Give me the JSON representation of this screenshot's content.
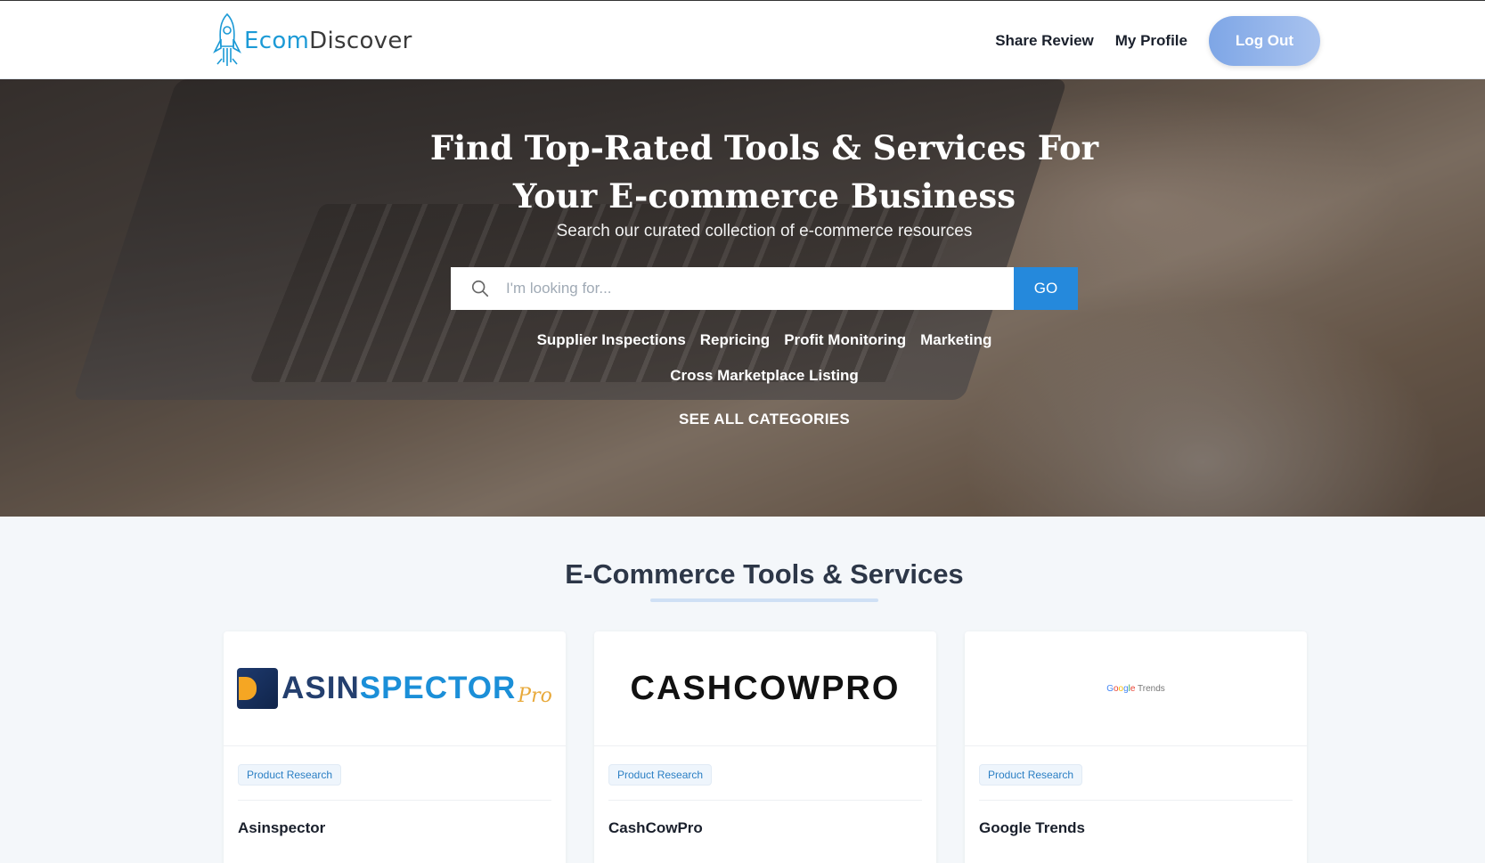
{
  "header": {
    "logo": {
      "part1": "Ecom",
      "part2": "Discover"
    },
    "nav": {
      "share_review": "Share Review",
      "my_profile": "My Profile",
      "log_out": "Log Out"
    }
  },
  "hero": {
    "title_line1": "Find Top-Rated Tools & Services For",
    "title_line2": "Your E-commerce Business",
    "subtitle": "Search our curated collection of e-commerce resources",
    "search": {
      "placeholder": "I'm looking for...",
      "value": "",
      "go_label": "GO"
    },
    "categories": [
      "Supplier Inspections",
      "Repricing",
      "Profit Monitoring",
      "Marketing",
      "Cross Marketplace Listing"
    ],
    "see_all": "SEE ALL CATEGORIES"
  },
  "tools": {
    "heading": "E-Commerce Tools & Services",
    "cards": [
      {
        "logo": {
          "a": "ASIN",
          "b": "SPECTOR",
          "pro": "Pro"
        },
        "tag": "Product Research",
        "name": "Asinspector"
      },
      {
        "logo": {
          "text": "CASHCOWPRO"
        },
        "tag": "Product Research",
        "name": "CashCowPro"
      },
      {
        "logo": {
          "g1": "G",
          "g2": "o",
          "g3": "o",
          "g4": "g",
          "g5": "l",
          "g6": "e",
          "trends": " Trends"
        },
        "tag": "Product Research",
        "name": "Google Trends"
      }
    ]
  },
  "colors": {
    "brand_blue": "#1c9ad6",
    "go_button": "#2589dc",
    "logout_gradient_start": "#7ea6e6",
    "logout_gradient_end": "#a9c3ef"
  },
  "icons": [
    "rocket-logo-icon",
    "search-icon"
  ]
}
